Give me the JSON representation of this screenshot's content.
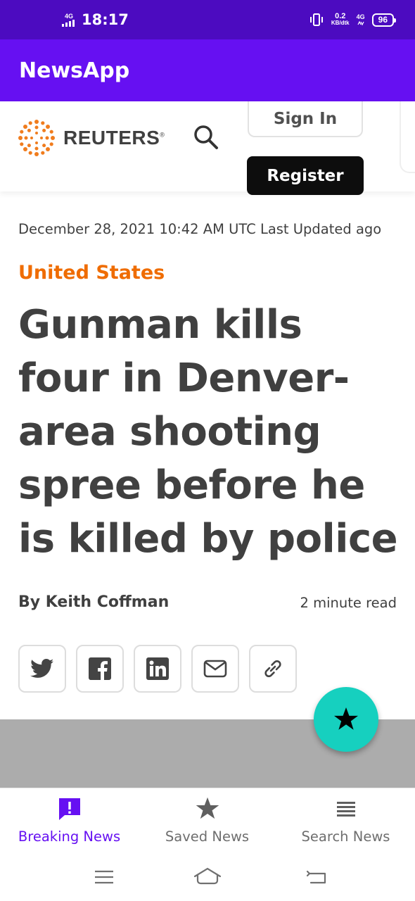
{
  "status_bar": {
    "network_left": "4G",
    "time": "18:17",
    "speed_value": "0.2",
    "speed_unit": "KB/dtk",
    "network_right": "4G",
    "battery": "96"
  },
  "app_bar": {
    "title": "NewsApp"
  },
  "site_header": {
    "logo_text": "REUTERS",
    "logo_mark": "®",
    "sign_in": "Sign In",
    "register": "Register"
  },
  "article": {
    "date_line": "December 28, 2021 10:42 AM UTC Last Updated ago",
    "category": "United States",
    "headline": "Gunman kills four in Denver-area shooting spree before he is killed by police",
    "author": "By Keith Coffman",
    "read_time": "2 minute read"
  },
  "share_icons": [
    "twitter-icon",
    "facebook-icon",
    "linkedin-icon",
    "email-icon",
    "link-icon"
  ],
  "colors": {
    "status_bar": "#4c0bc0",
    "app_bar": "#6610f2",
    "category": "#ef6c00",
    "fab": "#16d0bf",
    "active_nav": "#6610f2"
  },
  "bottom_nav": {
    "items": [
      {
        "label": "Breaking News",
        "icon": "alert-icon",
        "active": true
      },
      {
        "label": "Saved News",
        "icon": "star-icon",
        "active": false
      },
      {
        "label": "Search News",
        "icon": "list-icon",
        "active": false
      }
    ]
  }
}
